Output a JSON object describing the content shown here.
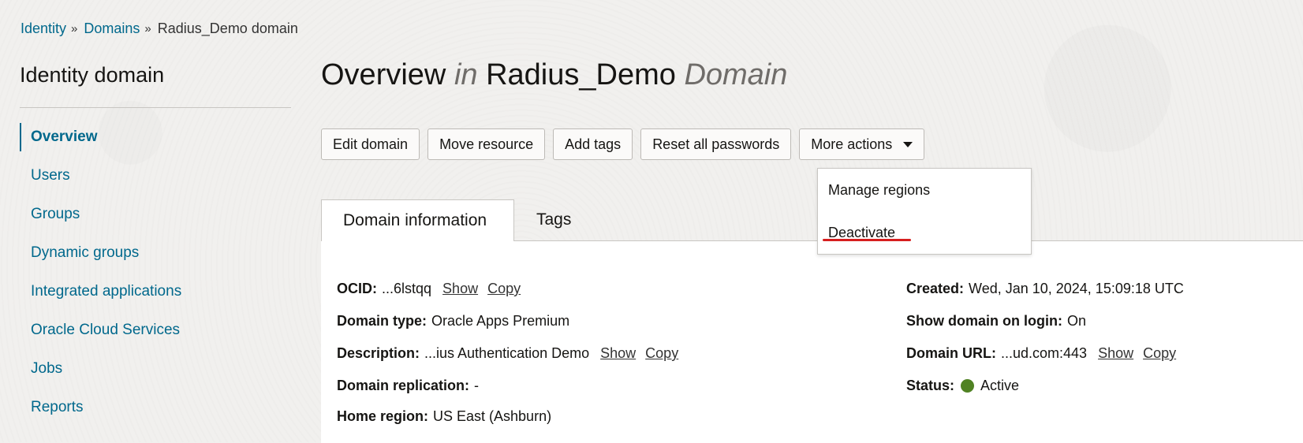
{
  "breadcrumb": {
    "items": [
      "Identity",
      "Domains"
    ],
    "current": "Radius_Demo domain",
    "separator": "»"
  },
  "sidebar": {
    "title": "Identity domain",
    "items": [
      {
        "label": "Overview",
        "active": true
      },
      {
        "label": "Users"
      },
      {
        "label": "Groups"
      },
      {
        "label": "Dynamic groups"
      },
      {
        "label": "Integrated applications"
      },
      {
        "label": "Oracle Cloud Services"
      },
      {
        "label": "Jobs"
      },
      {
        "label": "Reports"
      }
    ]
  },
  "header": {
    "title_part1": "Overview",
    "title_in": "in",
    "title_part2": "Radius_Demo",
    "title_domain": "Domain"
  },
  "toolbar": {
    "edit": "Edit domain",
    "move": "Move resource",
    "tags": "Add tags",
    "reset": "Reset all passwords",
    "more": "More actions"
  },
  "more_menu": {
    "items": [
      "Manage regions",
      "Deactivate"
    ]
  },
  "tabs": [
    "Domain information",
    "Tags"
  ],
  "details": {
    "ocid_label": "OCID:",
    "ocid_value": "...6lstqq",
    "type_label": "Domain type:",
    "type_value": "Oracle Apps Premium",
    "desc_label": "Description:",
    "desc_value": "...ius Authentication Demo",
    "replication_label": "Domain replication:",
    "replication_value": "-",
    "home_label": "Home region:",
    "home_value": "US East (Ashburn)",
    "created_label": "Created:",
    "created_value": "Wed, Jan 10, 2024, 15:09:18 UTC",
    "login_label": "Show domain on login:",
    "login_value": "On",
    "url_label": "Domain URL:",
    "url_value": "...ud.com:443",
    "status_label": "Status:",
    "status_value": "Active",
    "show": "Show",
    "copy": "Copy"
  },
  "colors": {
    "link": "#00688c",
    "status_active": "#508223",
    "highlight": "#d61e1e"
  }
}
